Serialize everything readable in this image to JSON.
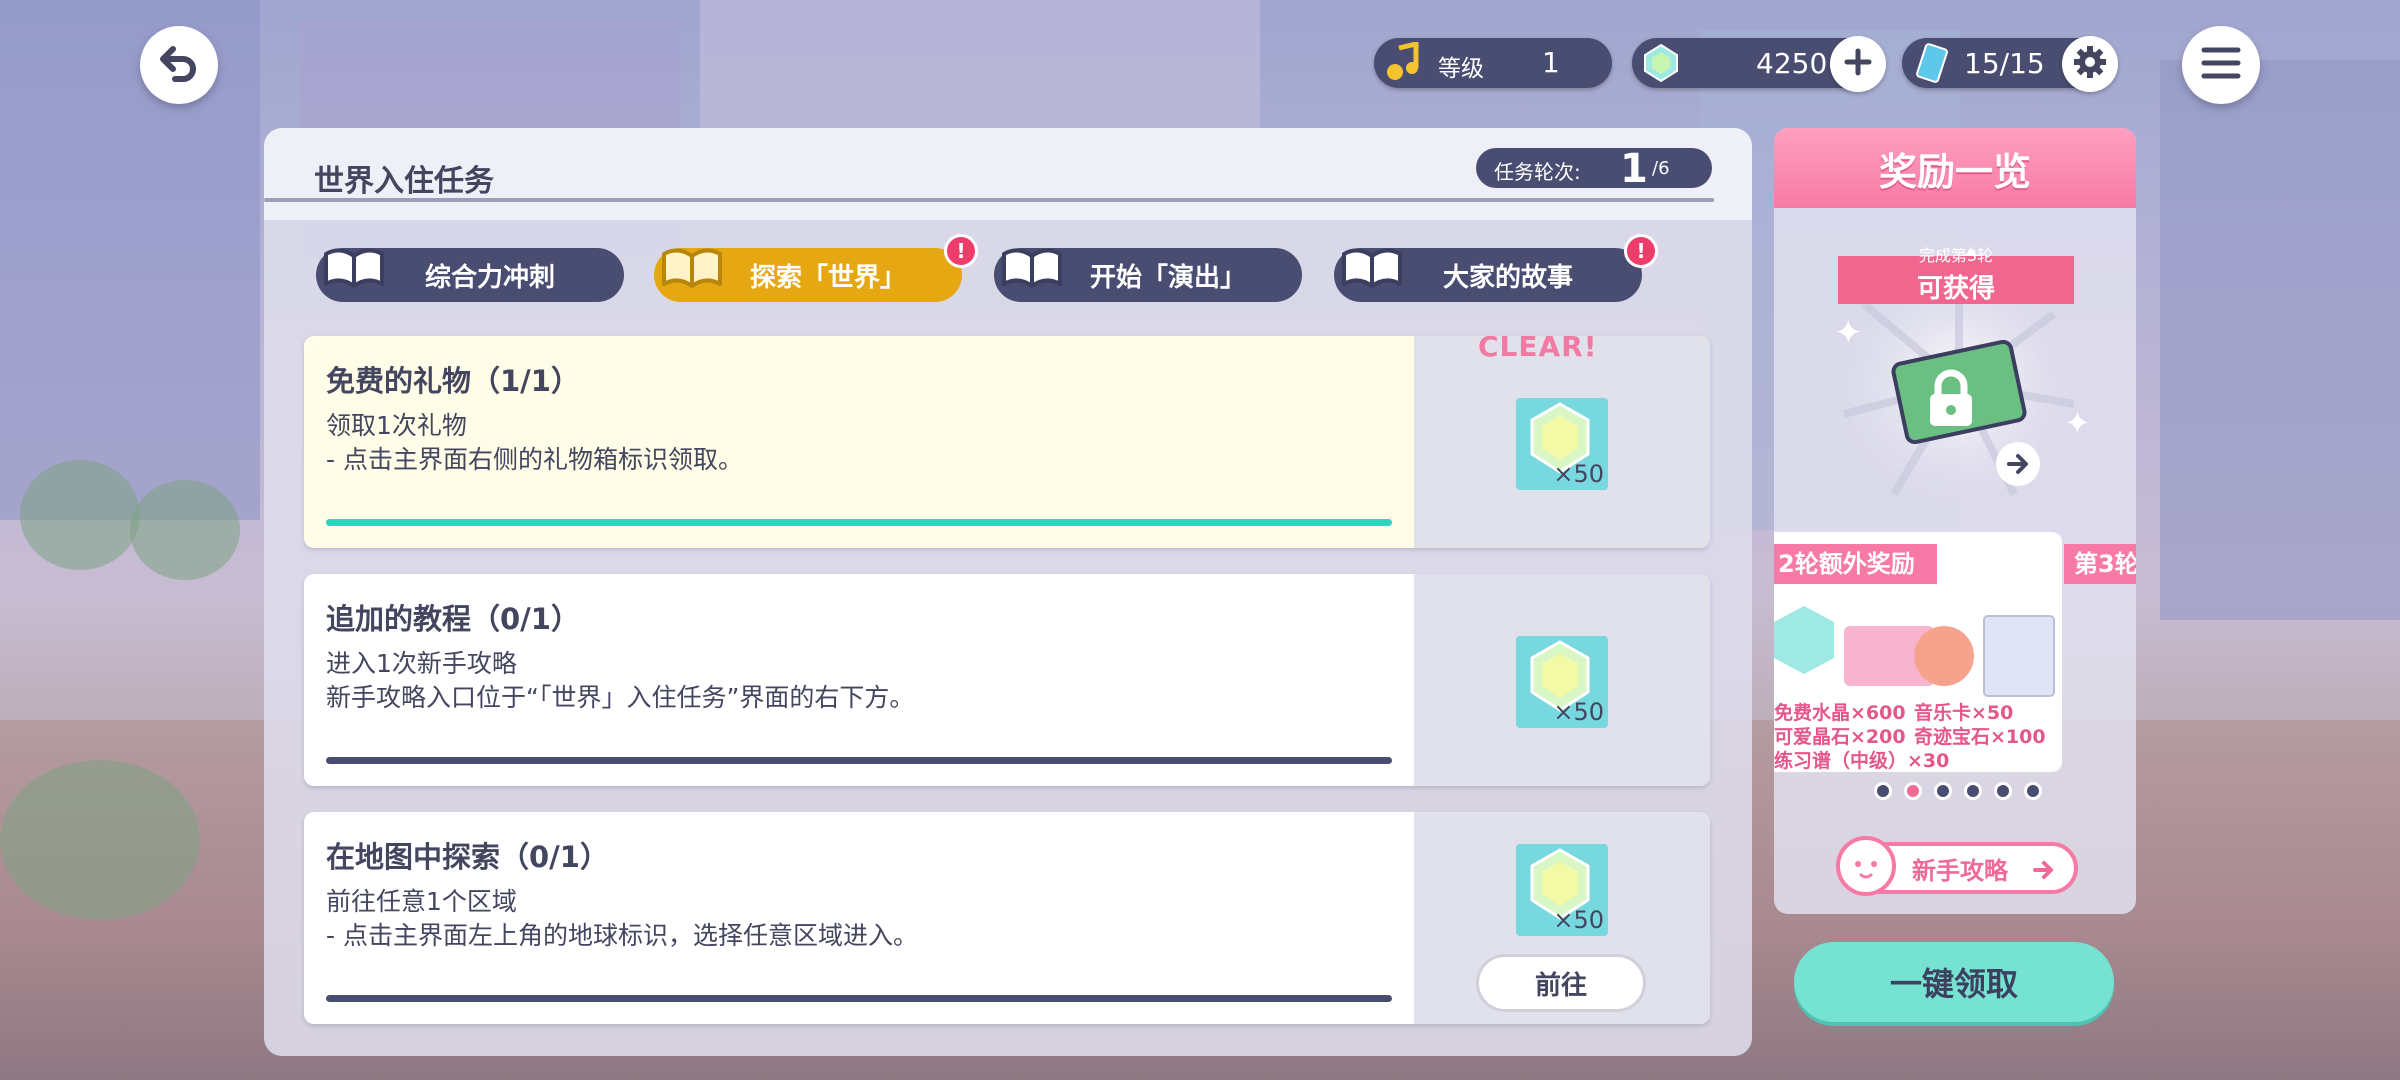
{
  "top_bar": {
    "level_label": "等级",
    "level_value": "1",
    "crystal_value": "4250",
    "ticket_value": "15/15"
  },
  "panel": {
    "title": "世界入住任务",
    "round_label": "任务轮次:",
    "round_current": "1",
    "round_total": "/6"
  },
  "tabs": [
    {
      "label": "综合力冲刺",
      "active": false,
      "alert": false
    },
    {
      "label": "探索「世界」",
      "active": true,
      "alert": true
    },
    {
      "label": "开始「演出」",
      "active": false,
      "alert": false
    },
    {
      "label": "大家的故事",
      "active": false,
      "alert": true
    }
  ],
  "alert_mark": "!",
  "missions": [
    {
      "title": "免费的礼物（1/1）",
      "line1": "领取1次礼物",
      "line2": "- 点击主界面右侧的礼物箱标识领取。",
      "reward_qty": "×50",
      "status": "CLEAR!",
      "progress": 1
    },
    {
      "title": "追加的教程（0/1）",
      "line1": "进入1次新手攻略",
      "line2": "新手攻略入口位于“「世界」入住任务”界面的右下方。",
      "reward_qty": "×50",
      "progress": 0
    },
    {
      "title": "在地图中探索（0/1）",
      "line1": "前往任意1个区域",
      "line2": "- 点击主界面左上角的地球标识，选择任意区域进入。",
      "reward_qty": "×50",
      "go_label": "前往",
      "progress": 0
    }
  ],
  "rewards": {
    "header": "奖励一览",
    "ribbon_small": "完成第3轮",
    "ribbon_big": "可获得",
    "bonus_banner": "2轮额外奖励",
    "next_banner": "第3轮",
    "bonus_items": [
      "免费水晶×600",
      "音乐卡×50",
      "可爱晶石×200",
      "奇迹宝石×100",
      "练习谱（中级）×30"
    ],
    "page_count": 6,
    "current_page": 2,
    "guide_label": "新手攻略"
  },
  "claim_all_label": "一键领取",
  "colors": {
    "navy": "#4a4d72",
    "tab_active": "#e6a812",
    "pink": "#f77aa6",
    "teal": "#76e2d2",
    "progress_done": "#33d1c0"
  },
  "icons": [
    "back-icon",
    "music-note-icon",
    "crystal-icon",
    "plus-icon",
    "ticket-icon",
    "gear-icon",
    "menu-icon",
    "book-icon",
    "gem-icon",
    "lock-icon",
    "arrow-right-icon"
  ]
}
